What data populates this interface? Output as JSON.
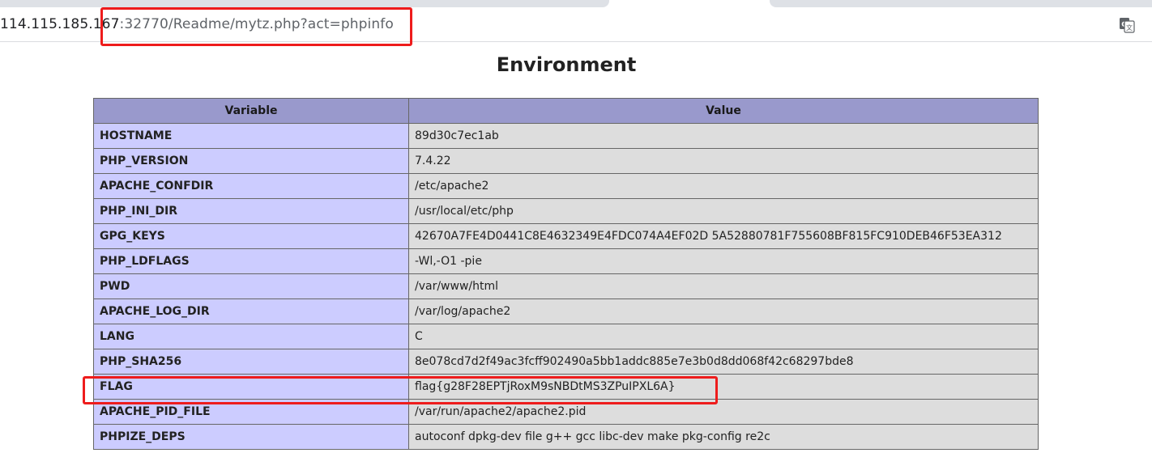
{
  "browser": {
    "url_host": "114.115.185.167",
    "url_rest": ":32770/Readme/mytz.php?act=phpinfo",
    "translate_icon": "translate-icon"
  },
  "page": {
    "title": "Environment",
    "columns": [
      "Variable",
      "Value"
    ],
    "rows": [
      {
        "variable": "HOSTNAME",
        "value": "89d30c7ec1ab"
      },
      {
        "variable": "PHP_VERSION",
        "value": "7.4.22"
      },
      {
        "variable": "APACHE_CONFDIR",
        "value": "/etc/apache2"
      },
      {
        "variable": "PHP_INI_DIR",
        "value": "/usr/local/etc/php"
      },
      {
        "variable": "GPG_KEYS",
        "value": "42670A7FE4D0441C8E4632349E4FDC074A4EF02D 5A52880781F755608BF815FC910DEB46F53EA312"
      },
      {
        "variable": "PHP_LDFLAGS",
        "value": "-Wl,-O1 -pie"
      },
      {
        "variable": "PWD",
        "value": "/var/www/html"
      },
      {
        "variable": "APACHE_LOG_DIR",
        "value": "/var/log/apache2"
      },
      {
        "variable": "LANG",
        "value": "C"
      },
      {
        "variable": "PHP_SHA256",
        "value": "8e078cd7d2f49ac3fcff902490a5bb1addc885e7e3b0d8dd068f42c68297bde8"
      },
      {
        "variable": "FLAG",
        "value": "flag{g28F28EPTjRoxM9sNBDtMS3ZPuIPXL6A}"
      },
      {
        "variable": "APACHE_PID_FILE",
        "value": "/var/run/apache2/apache2.pid"
      },
      {
        "variable": "PHPIZE_DEPS",
        "value": "autoconf dpkg-dev file g++ gcc libc-dev make pkg-config re2c"
      }
    ]
  },
  "colors": {
    "header_bg": "#9999cc",
    "variable_bg": "#ccccff",
    "value_bg": "#dddddd",
    "highlight": "#ee1c1c"
  }
}
